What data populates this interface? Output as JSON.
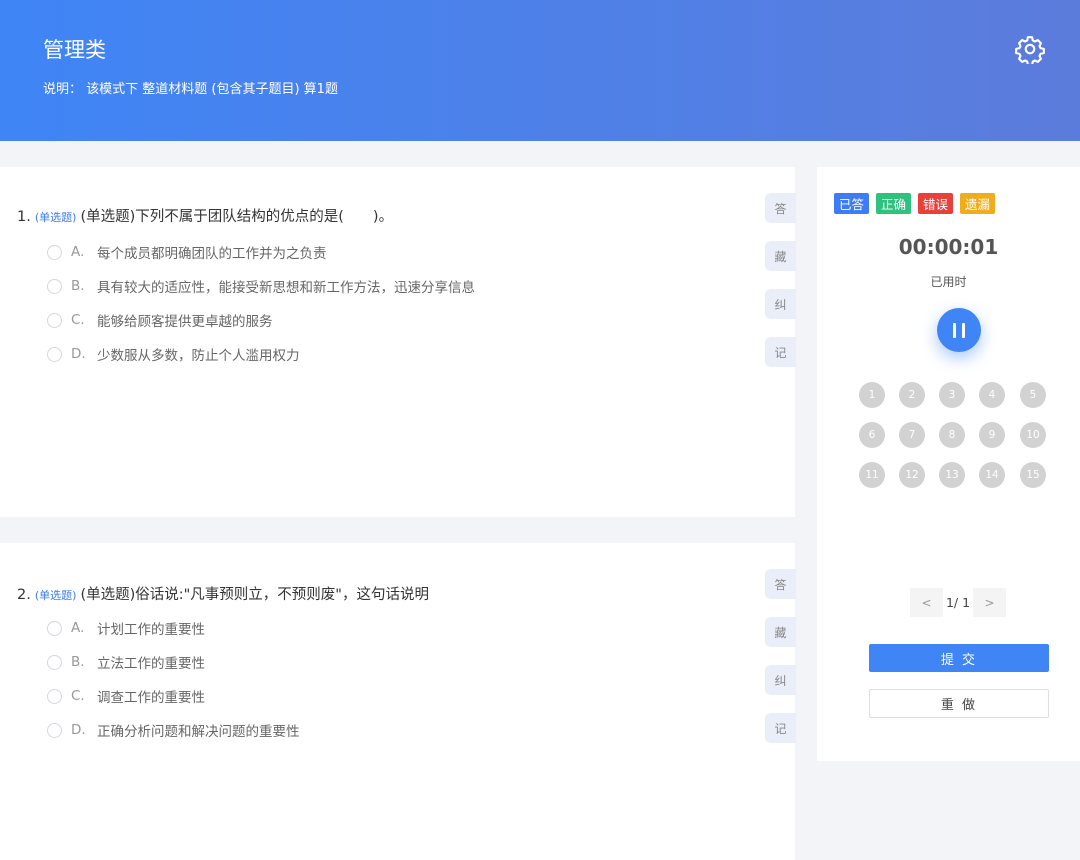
{
  "header": {
    "title": "管理类",
    "description": "说明： 该模式下 整道材料题 (包含其子题目) 算1题",
    "settings_icon": "gear-icon"
  },
  "questions": [
    {
      "number": "1.",
      "tag": "(单选题)",
      "text": "(单选题)下列不属于团队结构的优点的是(　　)。",
      "options": [
        {
          "letter": "A.",
          "text": "每个成员都明确团队的工作并为之负责"
        },
        {
          "letter": "B.",
          "text": "具有较大的适应性，能接受新思想和新工作方法，迅速分享信息"
        },
        {
          "letter": "C.",
          "text": "能够给顾客提供更卓越的服务"
        },
        {
          "letter": "D.",
          "text": "少数服从多数，防止个人滥用权力"
        }
      ],
      "actions": [
        "答",
        "藏",
        "纠",
        "记"
      ]
    },
    {
      "number": "2.",
      "tag": "(单选题)",
      "text": "(单选题)俗话说:\"凡事预则立，不预则废\"，这句话说明",
      "options": [
        {
          "letter": "A.",
          "text": "计划工作的重要性"
        },
        {
          "letter": "B.",
          "text": "立法工作的重要性"
        },
        {
          "letter": "C.",
          "text": "调查工作的重要性"
        },
        {
          "letter": "D.",
          "text": "正确分析问题和解决问题的重要性"
        }
      ],
      "actions": [
        "答",
        "藏",
        "纠",
        "记"
      ]
    }
  ],
  "panel": {
    "legend": [
      {
        "label": "已答",
        "color": "#3d7cf5"
      },
      {
        "label": "正确",
        "color": "#2ec27e"
      },
      {
        "label": "错误",
        "color": "#e8413c"
      },
      {
        "label": "遗漏",
        "color": "#f0ad1b"
      }
    ],
    "timer": "00:00:01",
    "timer_label": "已用时",
    "pause_icon": "pause-icon",
    "question_numbers": [
      "1",
      "2",
      "3",
      "4",
      "5",
      "6",
      "7",
      "8",
      "9",
      "10",
      "11",
      "12",
      "13",
      "14",
      "15"
    ],
    "pager": {
      "prev": "<",
      "text": "1/ 1",
      "next": ">"
    },
    "submit_label": "提 交",
    "redo_label": "重 做"
  }
}
